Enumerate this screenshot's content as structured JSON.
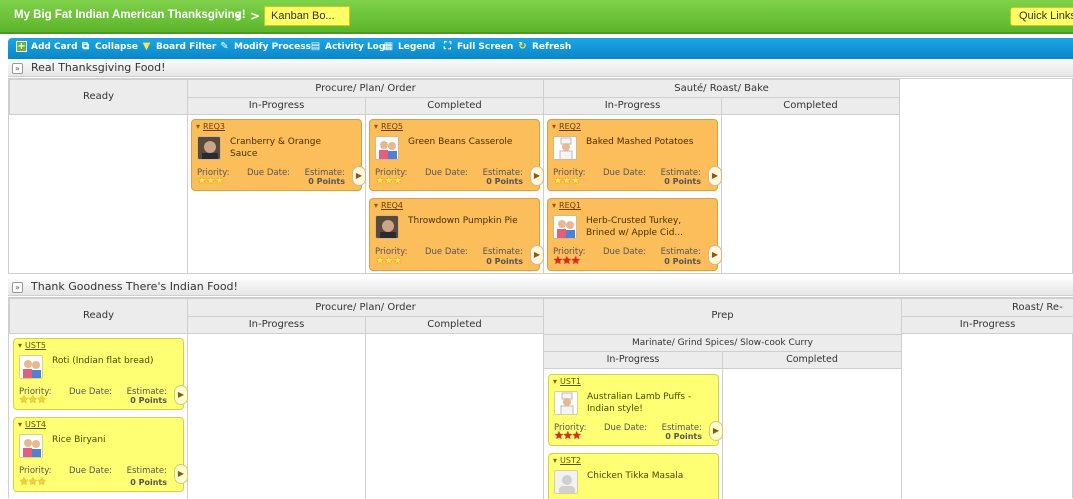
{
  "topbar": {
    "project_title": "My Big Fat Indian American Thanksgiving!",
    "caret": "▾",
    "separator": ">",
    "board_tab": "Kanban Bo...",
    "quick_links": "Quick Links"
  },
  "toolbar": {
    "add_card": "Add Card",
    "collapse": "Collapse",
    "board_filter": "Board Filter",
    "modify_process": "Modify Process",
    "activity_log": "Activity Log",
    "legend": "Legend",
    "full_screen": "Full Screen",
    "refresh": "Refresh"
  },
  "labels": {
    "priority": "Priority:",
    "due_date": "Due Date:",
    "estimate": "Estimate:"
  },
  "lane1": {
    "title": "Real Thanksgiving Food!",
    "toggle": "»",
    "ready": "Ready",
    "group1": "Procure/ Plan/ Order",
    "group2": "Sauté/ Roast/ Bake",
    "in_progress": "In-Progress",
    "completed": "Completed",
    "cards": [
      {
        "id": "REQ3",
        "title": "Cranberry & Orange Sauce",
        "points": "0 Points",
        "stars": "★★★",
        "avatar": "portrait-photo"
      },
      {
        "id": "REQ5",
        "title": "Green Beans Casserole",
        "points": "0 Points",
        "stars": "★★★",
        "avatar": "people-icon"
      },
      {
        "id": "REQ4",
        "title": "Throwdown Pumpkin Pie",
        "points": "0 Points",
        "stars": "★★★",
        "avatar": "portrait-photo"
      },
      {
        "id": "REQ2",
        "title": "Baked Mashed Potatoes",
        "points": "0 Points",
        "stars": "★★★",
        "avatar": "chef-icon"
      },
      {
        "id": "REQ1",
        "title": "Herb-Crusted Turkey, Brined w/ Apple Cid...",
        "points": "0 Points",
        "stars": "★★★",
        "avatar": "people-icon"
      }
    ]
  },
  "lane2": {
    "title": "Thank Goodness There's Indian Food!",
    "toggle": "»",
    "ready": "Ready",
    "group1": "Procure/ Plan/ Order",
    "group2": "Prep",
    "group3": "Roast/ Re-",
    "sub_group": "Marinate/ Grind Spices/ Slow-cook Curry",
    "in_progress": "In-Progress",
    "completed": "Completed",
    "cards": [
      {
        "id": "UST5",
        "title": "Roti (Indian flat bread)",
        "points": "0 Points",
        "stars": "★★★",
        "avatar": "people-icon"
      },
      {
        "id": "UST4",
        "title": "Rice Biryani",
        "points": "0 Points",
        "stars": "★★★",
        "avatar": "people-icon"
      },
      {
        "id": "UST1",
        "title": "Australian Lamb Puffs - Indian style!",
        "points": "0 Points",
        "stars": "★★★",
        "avatar": "chef-icon"
      },
      {
        "id": "UST2",
        "title": "Chicken Tikka Masala",
        "points": "",
        "stars": "",
        "avatar": "blank-avatar"
      }
    ]
  },
  "colors": {
    "topbar_green": "#5db52b",
    "toolbar_blue": "#0a86c8",
    "card_orange": "#fcbd5b",
    "card_yellow": "#ffff73",
    "star_red": "#e2261f"
  }
}
